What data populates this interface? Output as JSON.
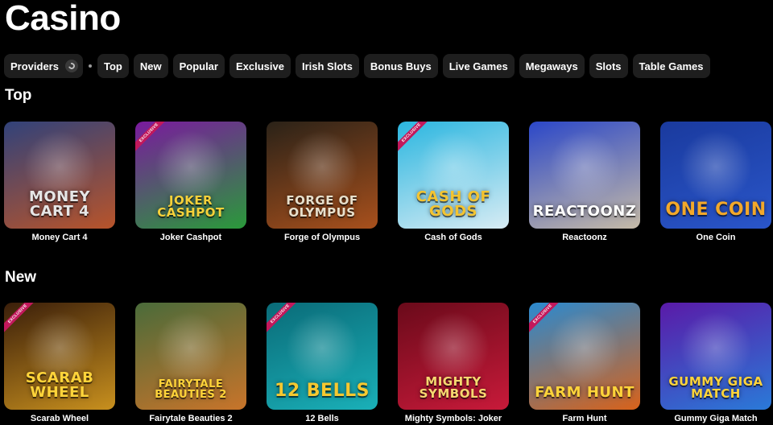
{
  "page": {
    "title": "Casino"
  },
  "filters": {
    "providers_label": "Providers",
    "chips": [
      "Top",
      "New",
      "Popular",
      "Exclusive",
      "Irish Slots",
      "Bonus Buys",
      "Live Games",
      "Megaways",
      "Slots",
      "Table Games"
    ]
  },
  "sections": [
    {
      "title": "Top",
      "games": [
        {
          "name": "Money Cart 4",
          "logo": "MONEY CART 4",
          "bg1": "#31427a",
          "bg2": "#b8542a",
          "logo_color": "#e6e6e6",
          "exclusive": false
        },
        {
          "name": "Joker Cashpot",
          "logo": "JOKER CASHPOT",
          "bg1": "#7a1a9e",
          "bg2": "#2a9a3a",
          "logo_color": "#f6d13a",
          "exclusive": true
        },
        {
          "name": "Forge of Olympus",
          "logo": "FORGE OF OLYMPUS",
          "bg1": "#2a2218",
          "bg2": "#a8501c",
          "logo_color": "#e8e0cc",
          "exclusive": false
        },
        {
          "name": "Cash of Gods",
          "logo": "CASH OF GODS",
          "bg1": "#2ab6e0",
          "bg2": "#d8ecf4",
          "logo_color": "#f3c431",
          "exclusive": true
        },
        {
          "name": "Reactoonz",
          "logo": "REACTOONZ",
          "bg1": "#2b47c8",
          "bg2": "#c6bba7",
          "logo_color": "#ffffff",
          "exclusive": false
        },
        {
          "name": "One Coin",
          "logo": "ONE COIN",
          "bg1": "#1a3a9e",
          "bg2": "#2a56c9",
          "logo_color": "#f2a82a",
          "exclusive": false
        }
      ]
    },
    {
      "title": "New",
      "games": [
        {
          "name": "Scarab Wheel",
          "logo": "SCARAB WHEEL",
          "bg1": "#3a1e0a",
          "bg2": "#c8901e",
          "logo_color": "#ffd43a",
          "exclusive": true
        },
        {
          "name": "Fairytale Beauties 2",
          "logo": "FAIRYTALE BEAUTIES 2",
          "bg1": "#4a6b3a",
          "bg2": "#c8742a",
          "logo_color": "#ffd43a",
          "exclusive": false
        },
        {
          "name": "12 Bells",
          "logo": "12 BELLS",
          "bg1": "#0a6b78",
          "bg2": "#1ab0b8",
          "logo_color": "#f6c830",
          "exclusive": true
        },
        {
          "name": "Mighty Symbols: Joker",
          "logo": "MIGHTY SYMBOLS",
          "bg1": "#6a0a1a",
          "bg2": "#c81a3a",
          "logo_color": "#f6d870",
          "exclusive": false
        },
        {
          "name": "Farm Hunt",
          "logo": "FARM HUNT",
          "bg1": "#2a8ad0",
          "bg2": "#d8621a",
          "logo_color": "#ffd43a",
          "exclusive": true
        },
        {
          "name": "Gummy Giga Match",
          "logo": "GUMMY GIGA MATCH",
          "bg1": "#5a1aa8",
          "bg2": "#2a7ad8",
          "logo_color": "#ffd43a",
          "exclusive": false
        }
      ]
    }
  ],
  "badge_text": "EXCLUSIVE"
}
